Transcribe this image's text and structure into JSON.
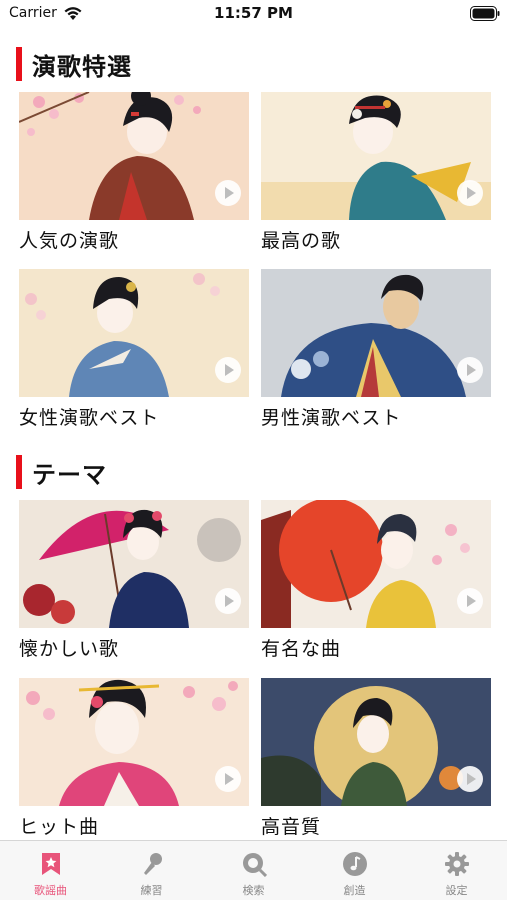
{
  "status_bar": {
    "carrier": "Carrier",
    "time": "11:57 PM"
  },
  "sections": [
    {
      "title": "演歌特選",
      "cards": [
        {
          "label": "人気の演歌"
        },
        {
          "label": "最高の歌"
        },
        {
          "label": "女性演歌ベスト"
        },
        {
          "label": "男性演歌ベスト"
        }
      ]
    },
    {
      "title": "テーマ",
      "cards": [
        {
          "label": "懐かしい歌"
        },
        {
          "label": "有名な曲"
        },
        {
          "label": "ヒット曲"
        },
        {
          "label": "高音質"
        }
      ]
    }
  ],
  "tab_bar": {
    "items": [
      {
        "label": "歌謡曲",
        "icon": "bookmark-star-icon",
        "active": true
      },
      {
        "label": "練習",
        "icon": "microphone-icon",
        "active": false
      },
      {
        "label": "検索",
        "icon": "search-icon",
        "active": false
      },
      {
        "label": "創造",
        "icon": "music-note-icon",
        "active": false
      },
      {
        "label": "設定",
        "icon": "gear-icon",
        "active": false
      }
    ]
  },
  "colors": {
    "accent": "#e8101a",
    "tab_active": "#e8547a",
    "tab_inactive": "#888888"
  }
}
